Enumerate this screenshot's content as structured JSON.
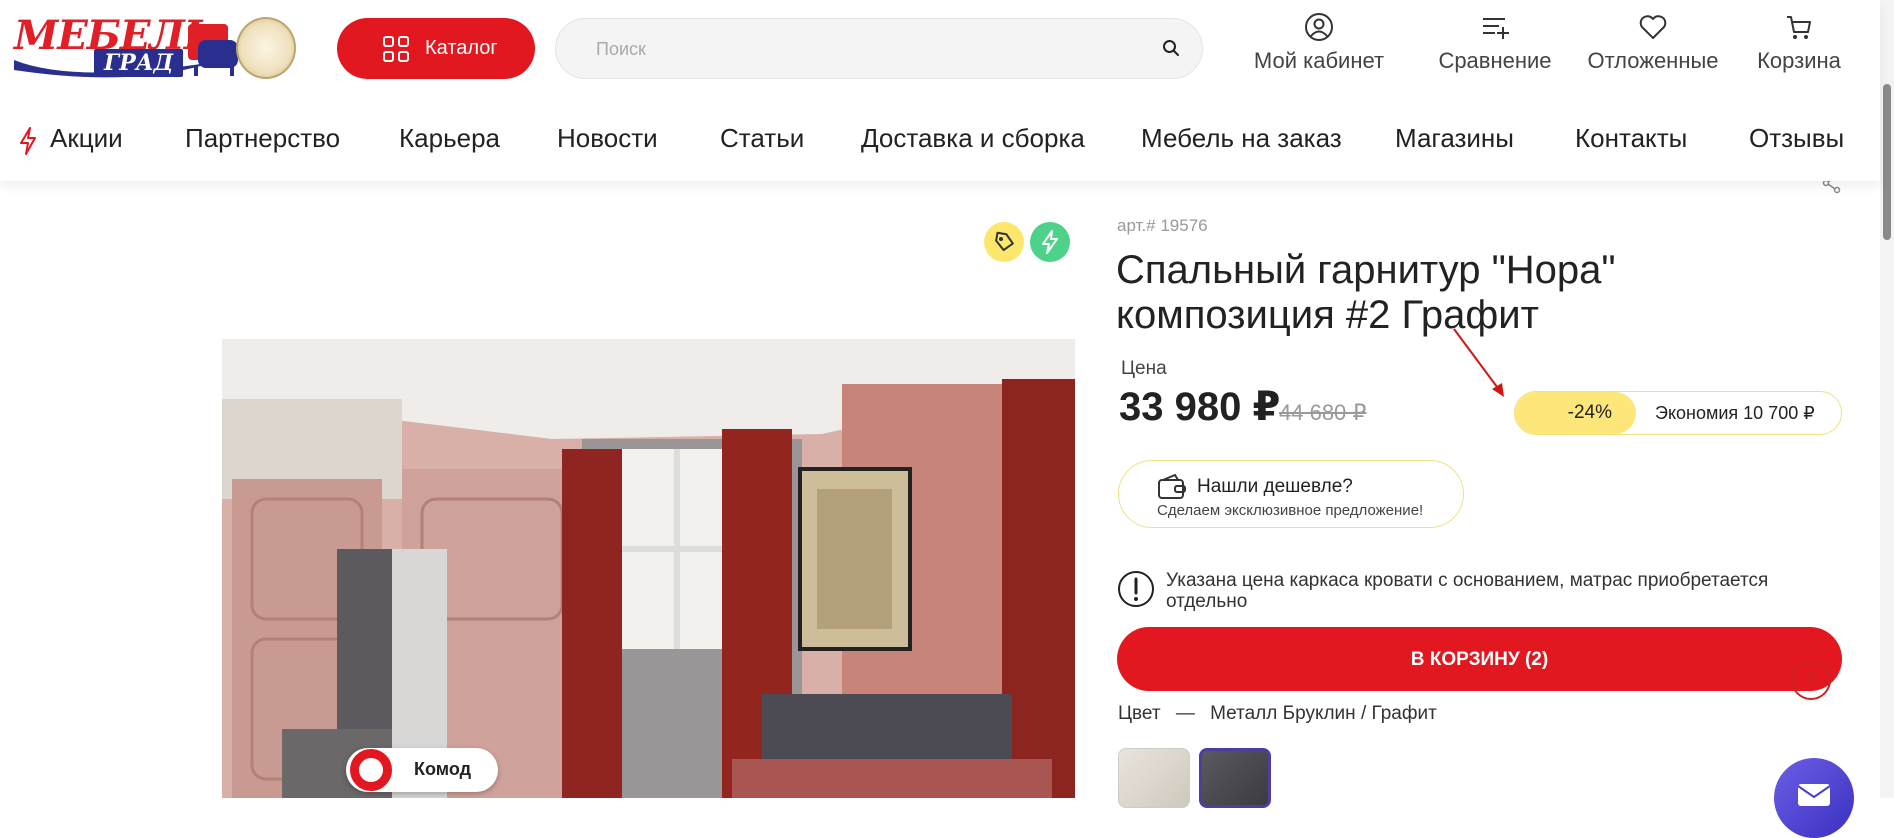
{
  "header": {
    "logo_text": "МЕБЕЛЬ",
    "logo_sub": "ГРАД",
    "catalog_label": "Каталог",
    "search_placeholder": "Поиск",
    "actions": [
      {
        "label": "Мой кабинет",
        "icon": "user-icon"
      },
      {
        "label": "Сравнение",
        "icon": "compare-icon"
      },
      {
        "label": "Отложенные",
        "icon": "heart-icon"
      },
      {
        "label": "Корзина",
        "icon": "cart-icon"
      }
    ]
  },
  "nav": {
    "items": [
      "Акции",
      "Партнерство",
      "Карьера",
      "Новости",
      "Статьи",
      "Доставка и сборка",
      "Мебель на заказ",
      "Магазины",
      "Контакты",
      "Отзывы"
    ]
  },
  "product": {
    "article": "арт.# 19576",
    "title_line1": "Спальный гарнитур \"Нора\"",
    "title_line2": "композиция #2 Графит",
    "price_label": "Цена",
    "price": "33 980 ₽",
    "old_price": "44 680 ₽",
    "discount_pct": "-24%",
    "economy": "Экономия 10 700 ₽",
    "cheaper_title": "Нашли дешевле?",
    "cheaper_sub": "Сделаем эксклюзивное предложение!",
    "notice": "Указана цена каркаса кровати с основанием, матрас приобретается отдельно",
    "cart_button": "В КОРЗИНУ (2)",
    "color_label": "Цвет",
    "color_sep": "—",
    "color_value": "Металл Бруклин / Графит",
    "image_tag": "Комод",
    "colors": {
      "brand_red": "#e3171f",
      "discount_yellow": "#fde77a",
      "badge_yellow": "#fbe76b",
      "badge_green": "#4cd389"
    }
  }
}
